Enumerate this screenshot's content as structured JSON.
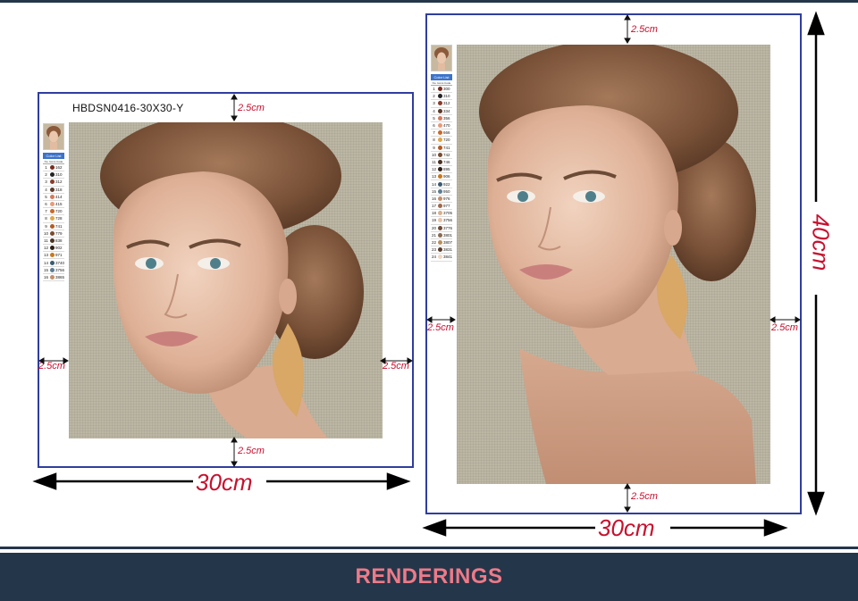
{
  "left_canvas": {
    "code": "HBDSN0416-30X30-Y",
    "margin_top": "2.5cm",
    "margin_left": "2.5cm",
    "margin_right": "2.5cm",
    "margin_bottom": "2.5cm",
    "width": "30cm"
  },
  "right_canvas": {
    "margin_top": "2.5cm",
    "margin_left": "2.5cm",
    "margin_right": "2.5cm",
    "margin_bottom": "2.5cm",
    "width": "30cm",
    "height": "40cm"
  },
  "color_list": {
    "title": "Color List",
    "header": "No. Icons Code",
    "left_codes": [
      "162",
      "310",
      "312",
      "318",
      "414",
      "415",
      "720",
      "728",
      "741",
      "779",
      "838",
      "902",
      "971",
      "3740",
      "3756",
      "3865"
    ],
    "right_codes": [
      "300",
      "310",
      "312",
      "334",
      "356",
      "470",
      "666",
      "720",
      "741",
      "742",
      "746",
      "895",
      "906",
      "922",
      "950",
      "976",
      "977",
      "3705",
      "3756",
      "3776",
      "3801",
      "3807",
      "3831",
      "3841"
    ]
  },
  "banner": {
    "title": "RENDERINGS"
  },
  "colors": {
    "frame": "#2f3e9e",
    "dimension_text": "#c8102e",
    "banner_bg": "#24364a",
    "banner_text": "#ee7a88",
    "canvas_bg": "#bcb7a4"
  }
}
